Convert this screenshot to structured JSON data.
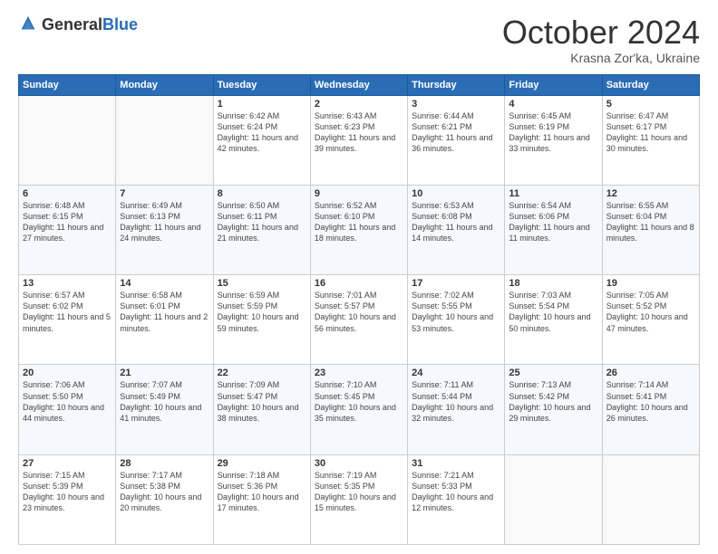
{
  "logo": {
    "general": "General",
    "blue": "Blue"
  },
  "header": {
    "month": "October 2024",
    "location": "Krasna Zor'ka, Ukraine"
  },
  "weekdays": [
    "Sunday",
    "Monday",
    "Tuesday",
    "Wednesday",
    "Thursday",
    "Friday",
    "Saturday"
  ],
  "weeks": [
    [
      {
        "day": "",
        "sunrise": "",
        "sunset": "",
        "daylight": ""
      },
      {
        "day": "",
        "sunrise": "",
        "sunset": "",
        "daylight": ""
      },
      {
        "day": "1",
        "sunrise": "Sunrise: 6:42 AM",
        "sunset": "Sunset: 6:24 PM",
        "daylight": "Daylight: 11 hours and 42 minutes."
      },
      {
        "day": "2",
        "sunrise": "Sunrise: 6:43 AM",
        "sunset": "Sunset: 6:23 PM",
        "daylight": "Daylight: 11 hours and 39 minutes."
      },
      {
        "day": "3",
        "sunrise": "Sunrise: 6:44 AM",
        "sunset": "Sunset: 6:21 PM",
        "daylight": "Daylight: 11 hours and 36 minutes."
      },
      {
        "day": "4",
        "sunrise": "Sunrise: 6:45 AM",
        "sunset": "Sunset: 6:19 PM",
        "daylight": "Daylight: 11 hours and 33 minutes."
      },
      {
        "day": "5",
        "sunrise": "Sunrise: 6:47 AM",
        "sunset": "Sunset: 6:17 PM",
        "daylight": "Daylight: 11 hours and 30 minutes."
      }
    ],
    [
      {
        "day": "6",
        "sunrise": "Sunrise: 6:48 AM",
        "sunset": "Sunset: 6:15 PM",
        "daylight": "Daylight: 11 hours and 27 minutes."
      },
      {
        "day": "7",
        "sunrise": "Sunrise: 6:49 AM",
        "sunset": "Sunset: 6:13 PM",
        "daylight": "Daylight: 11 hours and 24 minutes."
      },
      {
        "day": "8",
        "sunrise": "Sunrise: 6:50 AM",
        "sunset": "Sunset: 6:11 PM",
        "daylight": "Daylight: 11 hours and 21 minutes."
      },
      {
        "day": "9",
        "sunrise": "Sunrise: 6:52 AM",
        "sunset": "Sunset: 6:10 PM",
        "daylight": "Daylight: 11 hours and 18 minutes."
      },
      {
        "day": "10",
        "sunrise": "Sunrise: 6:53 AM",
        "sunset": "Sunset: 6:08 PM",
        "daylight": "Daylight: 11 hours and 14 minutes."
      },
      {
        "day": "11",
        "sunrise": "Sunrise: 6:54 AM",
        "sunset": "Sunset: 6:06 PM",
        "daylight": "Daylight: 11 hours and 11 minutes."
      },
      {
        "day": "12",
        "sunrise": "Sunrise: 6:55 AM",
        "sunset": "Sunset: 6:04 PM",
        "daylight": "Daylight: 11 hours and 8 minutes."
      }
    ],
    [
      {
        "day": "13",
        "sunrise": "Sunrise: 6:57 AM",
        "sunset": "Sunset: 6:02 PM",
        "daylight": "Daylight: 11 hours and 5 minutes."
      },
      {
        "day": "14",
        "sunrise": "Sunrise: 6:58 AM",
        "sunset": "Sunset: 6:01 PM",
        "daylight": "Daylight: 11 hours and 2 minutes."
      },
      {
        "day": "15",
        "sunrise": "Sunrise: 6:59 AM",
        "sunset": "Sunset: 5:59 PM",
        "daylight": "Daylight: 10 hours and 59 minutes."
      },
      {
        "day": "16",
        "sunrise": "Sunrise: 7:01 AM",
        "sunset": "Sunset: 5:57 PM",
        "daylight": "Daylight: 10 hours and 56 minutes."
      },
      {
        "day": "17",
        "sunrise": "Sunrise: 7:02 AM",
        "sunset": "Sunset: 5:55 PM",
        "daylight": "Daylight: 10 hours and 53 minutes."
      },
      {
        "day": "18",
        "sunrise": "Sunrise: 7:03 AM",
        "sunset": "Sunset: 5:54 PM",
        "daylight": "Daylight: 10 hours and 50 minutes."
      },
      {
        "day": "19",
        "sunrise": "Sunrise: 7:05 AM",
        "sunset": "Sunset: 5:52 PM",
        "daylight": "Daylight: 10 hours and 47 minutes."
      }
    ],
    [
      {
        "day": "20",
        "sunrise": "Sunrise: 7:06 AM",
        "sunset": "Sunset: 5:50 PM",
        "daylight": "Daylight: 10 hours and 44 minutes."
      },
      {
        "day": "21",
        "sunrise": "Sunrise: 7:07 AM",
        "sunset": "Sunset: 5:49 PM",
        "daylight": "Daylight: 10 hours and 41 minutes."
      },
      {
        "day": "22",
        "sunrise": "Sunrise: 7:09 AM",
        "sunset": "Sunset: 5:47 PM",
        "daylight": "Daylight: 10 hours and 38 minutes."
      },
      {
        "day": "23",
        "sunrise": "Sunrise: 7:10 AM",
        "sunset": "Sunset: 5:45 PM",
        "daylight": "Daylight: 10 hours and 35 minutes."
      },
      {
        "day": "24",
        "sunrise": "Sunrise: 7:11 AM",
        "sunset": "Sunset: 5:44 PM",
        "daylight": "Daylight: 10 hours and 32 minutes."
      },
      {
        "day": "25",
        "sunrise": "Sunrise: 7:13 AM",
        "sunset": "Sunset: 5:42 PM",
        "daylight": "Daylight: 10 hours and 29 minutes."
      },
      {
        "day": "26",
        "sunrise": "Sunrise: 7:14 AM",
        "sunset": "Sunset: 5:41 PM",
        "daylight": "Daylight: 10 hours and 26 minutes."
      }
    ],
    [
      {
        "day": "27",
        "sunrise": "Sunrise: 7:15 AM",
        "sunset": "Sunset: 5:39 PM",
        "daylight": "Daylight: 10 hours and 23 minutes."
      },
      {
        "day": "28",
        "sunrise": "Sunrise: 7:17 AM",
        "sunset": "Sunset: 5:38 PM",
        "daylight": "Daylight: 10 hours and 20 minutes."
      },
      {
        "day": "29",
        "sunrise": "Sunrise: 7:18 AM",
        "sunset": "Sunset: 5:36 PM",
        "daylight": "Daylight: 10 hours and 17 minutes."
      },
      {
        "day": "30",
        "sunrise": "Sunrise: 7:19 AM",
        "sunset": "Sunset: 5:35 PM",
        "daylight": "Daylight: 10 hours and 15 minutes."
      },
      {
        "day": "31",
        "sunrise": "Sunrise: 7:21 AM",
        "sunset": "Sunset: 5:33 PM",
        "daylight": "Daylight: 10 hours and 12 minutes."
      },
      {
        "day": "",
        "sunrise": "",
        "sunset": "",
        "daylight": ""
      },
      {
        "day": "",
        "sunrise": "",
        "sunset": "",
        "daylight": ""
      }
    ]
  ]
}
